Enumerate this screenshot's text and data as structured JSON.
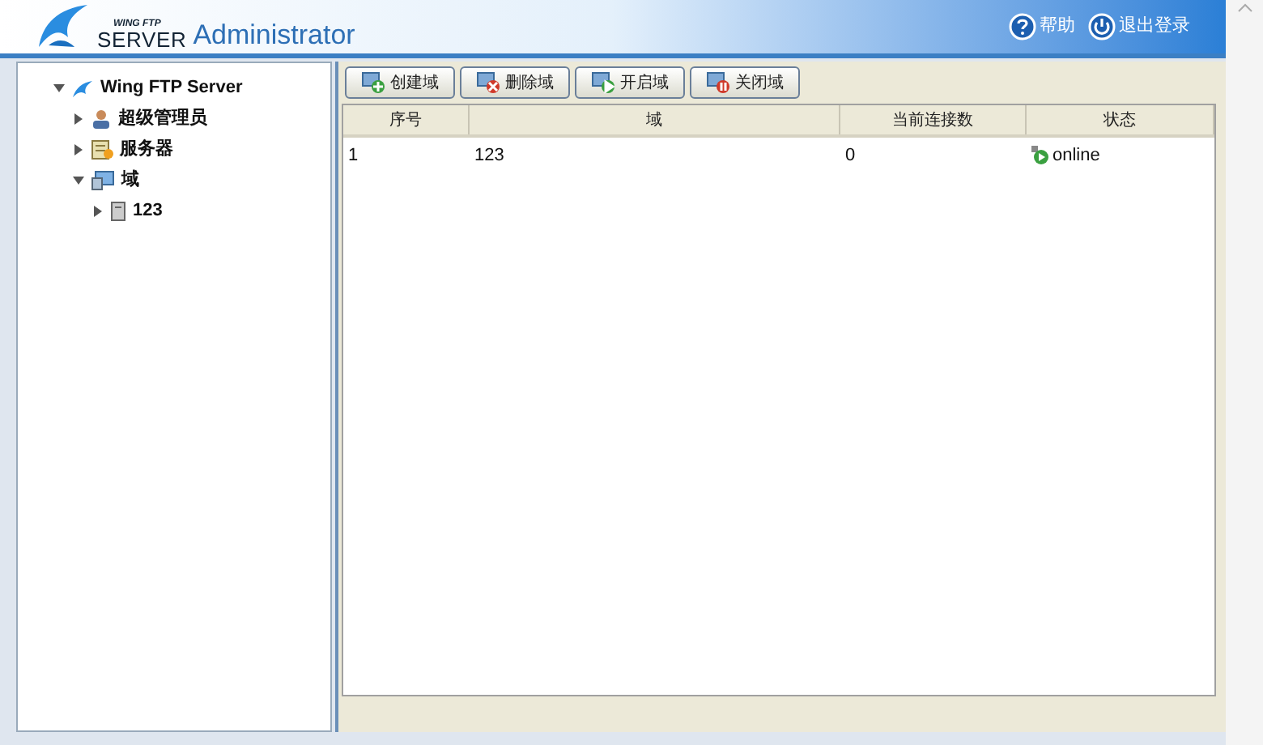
{
  "header": {
    "logo_top": "WING FTP",
    "logo_bottom": "SERVER",
    "title": "Administrator",
    "links": [
      {
        "kind": "help",
        "label": "帮助"
      },
      {
        "kind": "logout",
        "label": "退出登录"
      }
    ]
  },
  "tree": [
    {
      "label": "Wing FTP Server",
      "kind": "root",
      "expanded": true,
      "children": [
        {
          "label": "超级管理员",
          "kind": "user",
          "expanded": false
        },
        {
          "label": "服务器",
          "kind": "server",
          "expanded": false
        },
        {
          "label": "域",
          "kind": "domain",
          "expanded": true,
          "children": [
            {
              "label": "123",
              "kind": "host",
              "expanded": false
            }
          ]
        }
      ]
    }
  ],
  "toolbar": [
    {
      "kind": "create",
      "label": "创建域"
    },
    {
      "kind": "delete",
      "label": "删除域"
    },
    {
      "kind": "start",
      "label": "开启域"
    },
    {
      "kind": "stop",
      "label": "关闭域"
    }
  ],
  "table": {
    "columns": [
      "序号",
      "域",
      "当前连接数",
      "状态"
    ],
    "rows": [
      {
        "cells": [
          "1",
          "123",
          "0"
        ],
        "status": "online",
        "online": true
      }
    ]
  }
}
